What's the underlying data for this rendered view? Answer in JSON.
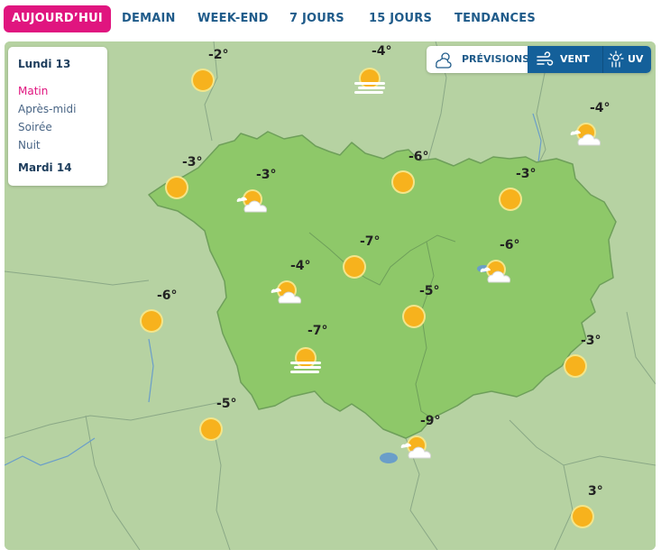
{
  "tabs": [
    {
      "label": "AUJOURD’HUI",
      "active": true
    },
    {
      "label": "DEMAIN",
      "active": false
    },
    {
      "label": "WEEK-END",
      "active": false
    },
    {
      "label": "7 JOURS",
      "active": false
    },
    {
      "label": "15 JOURS",
      "active": false
    },
    {
      "label": "TENDANCES",
      "active": false
    }
  ],
  "day_panel": {
    "day1": "Lundi 13",
    "periods": [
      {
        "label": "Matin",
        "active": true
      },
      {
        "label": "Après-midi",
        "active": false
      },
      {
        "label": "Soirée",
        "active": false
      },
      {
        "label": "Nuit",
        "active": false
      }
    ],
    "day2": "Mardi 14"
  },
  "toggle": {
    "previsions": "PRÉVISIONS",
    "vent": "VENT",
    "uv": "UV",
    "active": "vent"
  },
  "colors": {
    "accent": "#e0157f",
    "nav_text": "#1f5b8a",
    "toggle_active": "#14609a",
    "map_base": "#b6d2a2",
    "region_fill": "#8ec869",
    "sun": "#f7b21d"
  },
  "markers": [
    {
      "temp": "-2°",
      "icon": "sun-icon"
    },
    {
      "temp": "-4°",
      "icon": "fog-sun-icon"
    },
    {
      "temp": "-4°",
      "icon": "partly-cloudy-icon"
    },
    {
      "temp": "-3°",
      "icon": "sun-icon"
    },
    {
      "temp": "-3°",
      "icon": "partly-cloudy-icon"
    },
    {
      "temp": "-6°",
      "icon": "sun-icon"
    },
    {
      "temp": "-3°",
      "icon": "sun-icon"
    },
    {
      "temp": "-7°",
      "icon": "sun-icon"
    },
    {
      "temp": "-6°",
      "icon": "partly-cloudy-icon"
    },
    {
      "temp": "-4°",
      "icon": "partly-cloudy-icon"
    },
    {
      "temp": "-6°",
      "icon": "sun-icon"
    },
    {
      "temp": "-5°",
      "icon": "sun-icon"
    },
    {
      "temp": "-7°",
      "icon": "fog-sun-icon"
    },
    {
      "temp": "-3°",
      "icon": "sun-icon"
    },
    {
      "temp": "-5°",
      "icon": "sun-icon"
    },
    {
      "temp": "-9°",
      "icon": "partly-cloudy-icon"
    },
    {
      "temp": "3°",
      "icon": "sun-icon"
    }
  ]
}
